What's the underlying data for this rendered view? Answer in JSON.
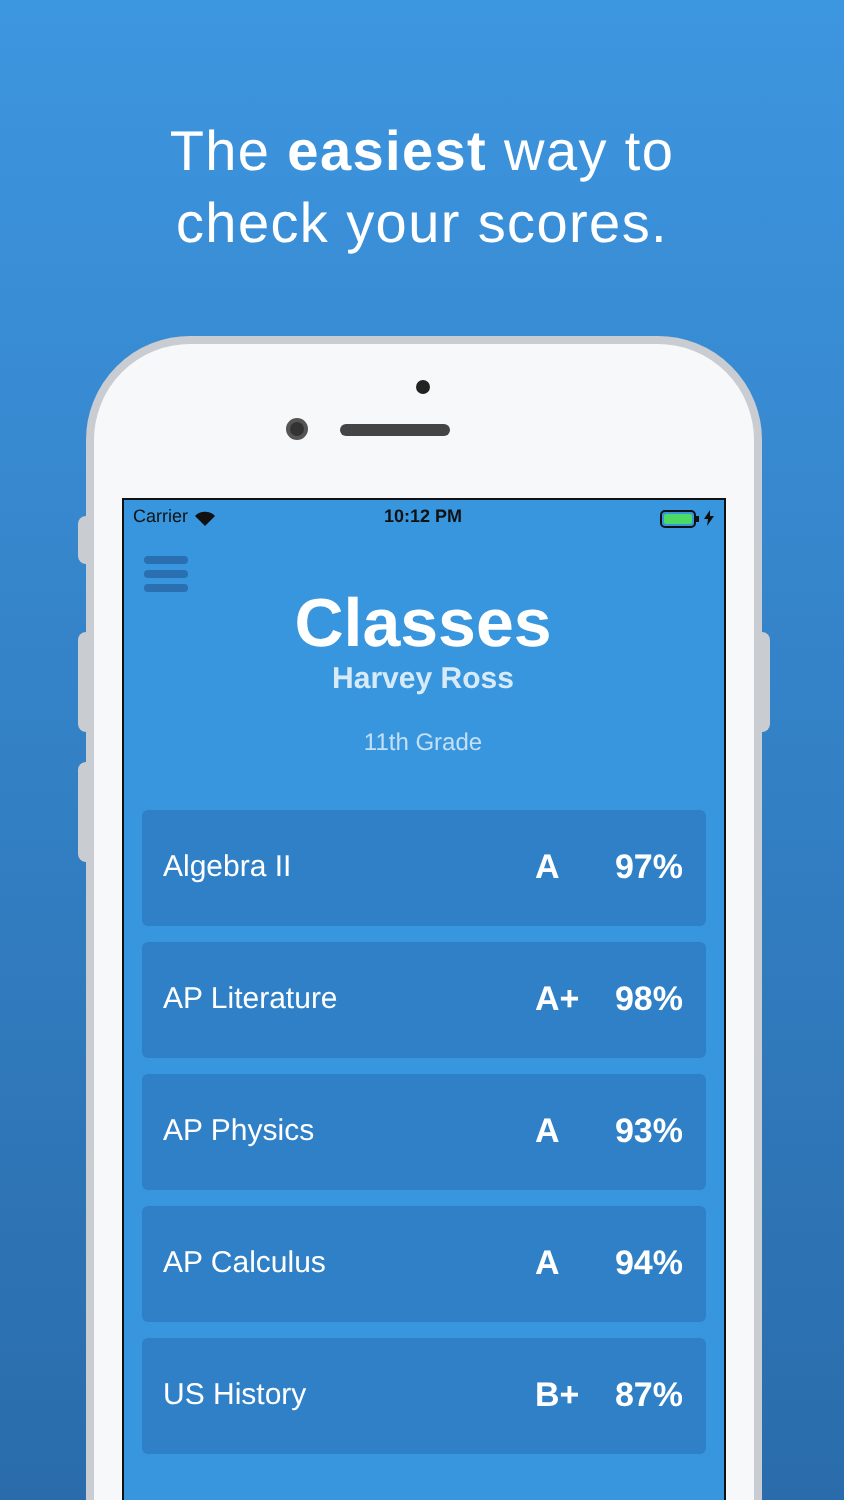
{
  "headline": "The **easiest** way to check your scores.",
  "status_bar": {
    "carrier": "Carrier",
    "time": "10:12 PM"
  },
  "header": {
    "title": "Classes",
    "student": "Harvey Ross",
    "grade_level": "11th Grade"
  },
  "classes": [
    {
      "name": "Algebra II",
      "grade": "A",
      "percent": "97%"
    },
    {
      "name": "AP Literature",
      "grade": "A+",
      "percent": "98%"
    },
    {
      "name": "AP Physics",
      "grade": "A",
      "percent": "93%"
    },
    {
      "name": "AP Calculus",
      "grade": "A",
      "percent": "94%"
    },
    {
      "name": "US History",
      "grade": "B+",
      "percent": "87%"
    }
  ]
}
